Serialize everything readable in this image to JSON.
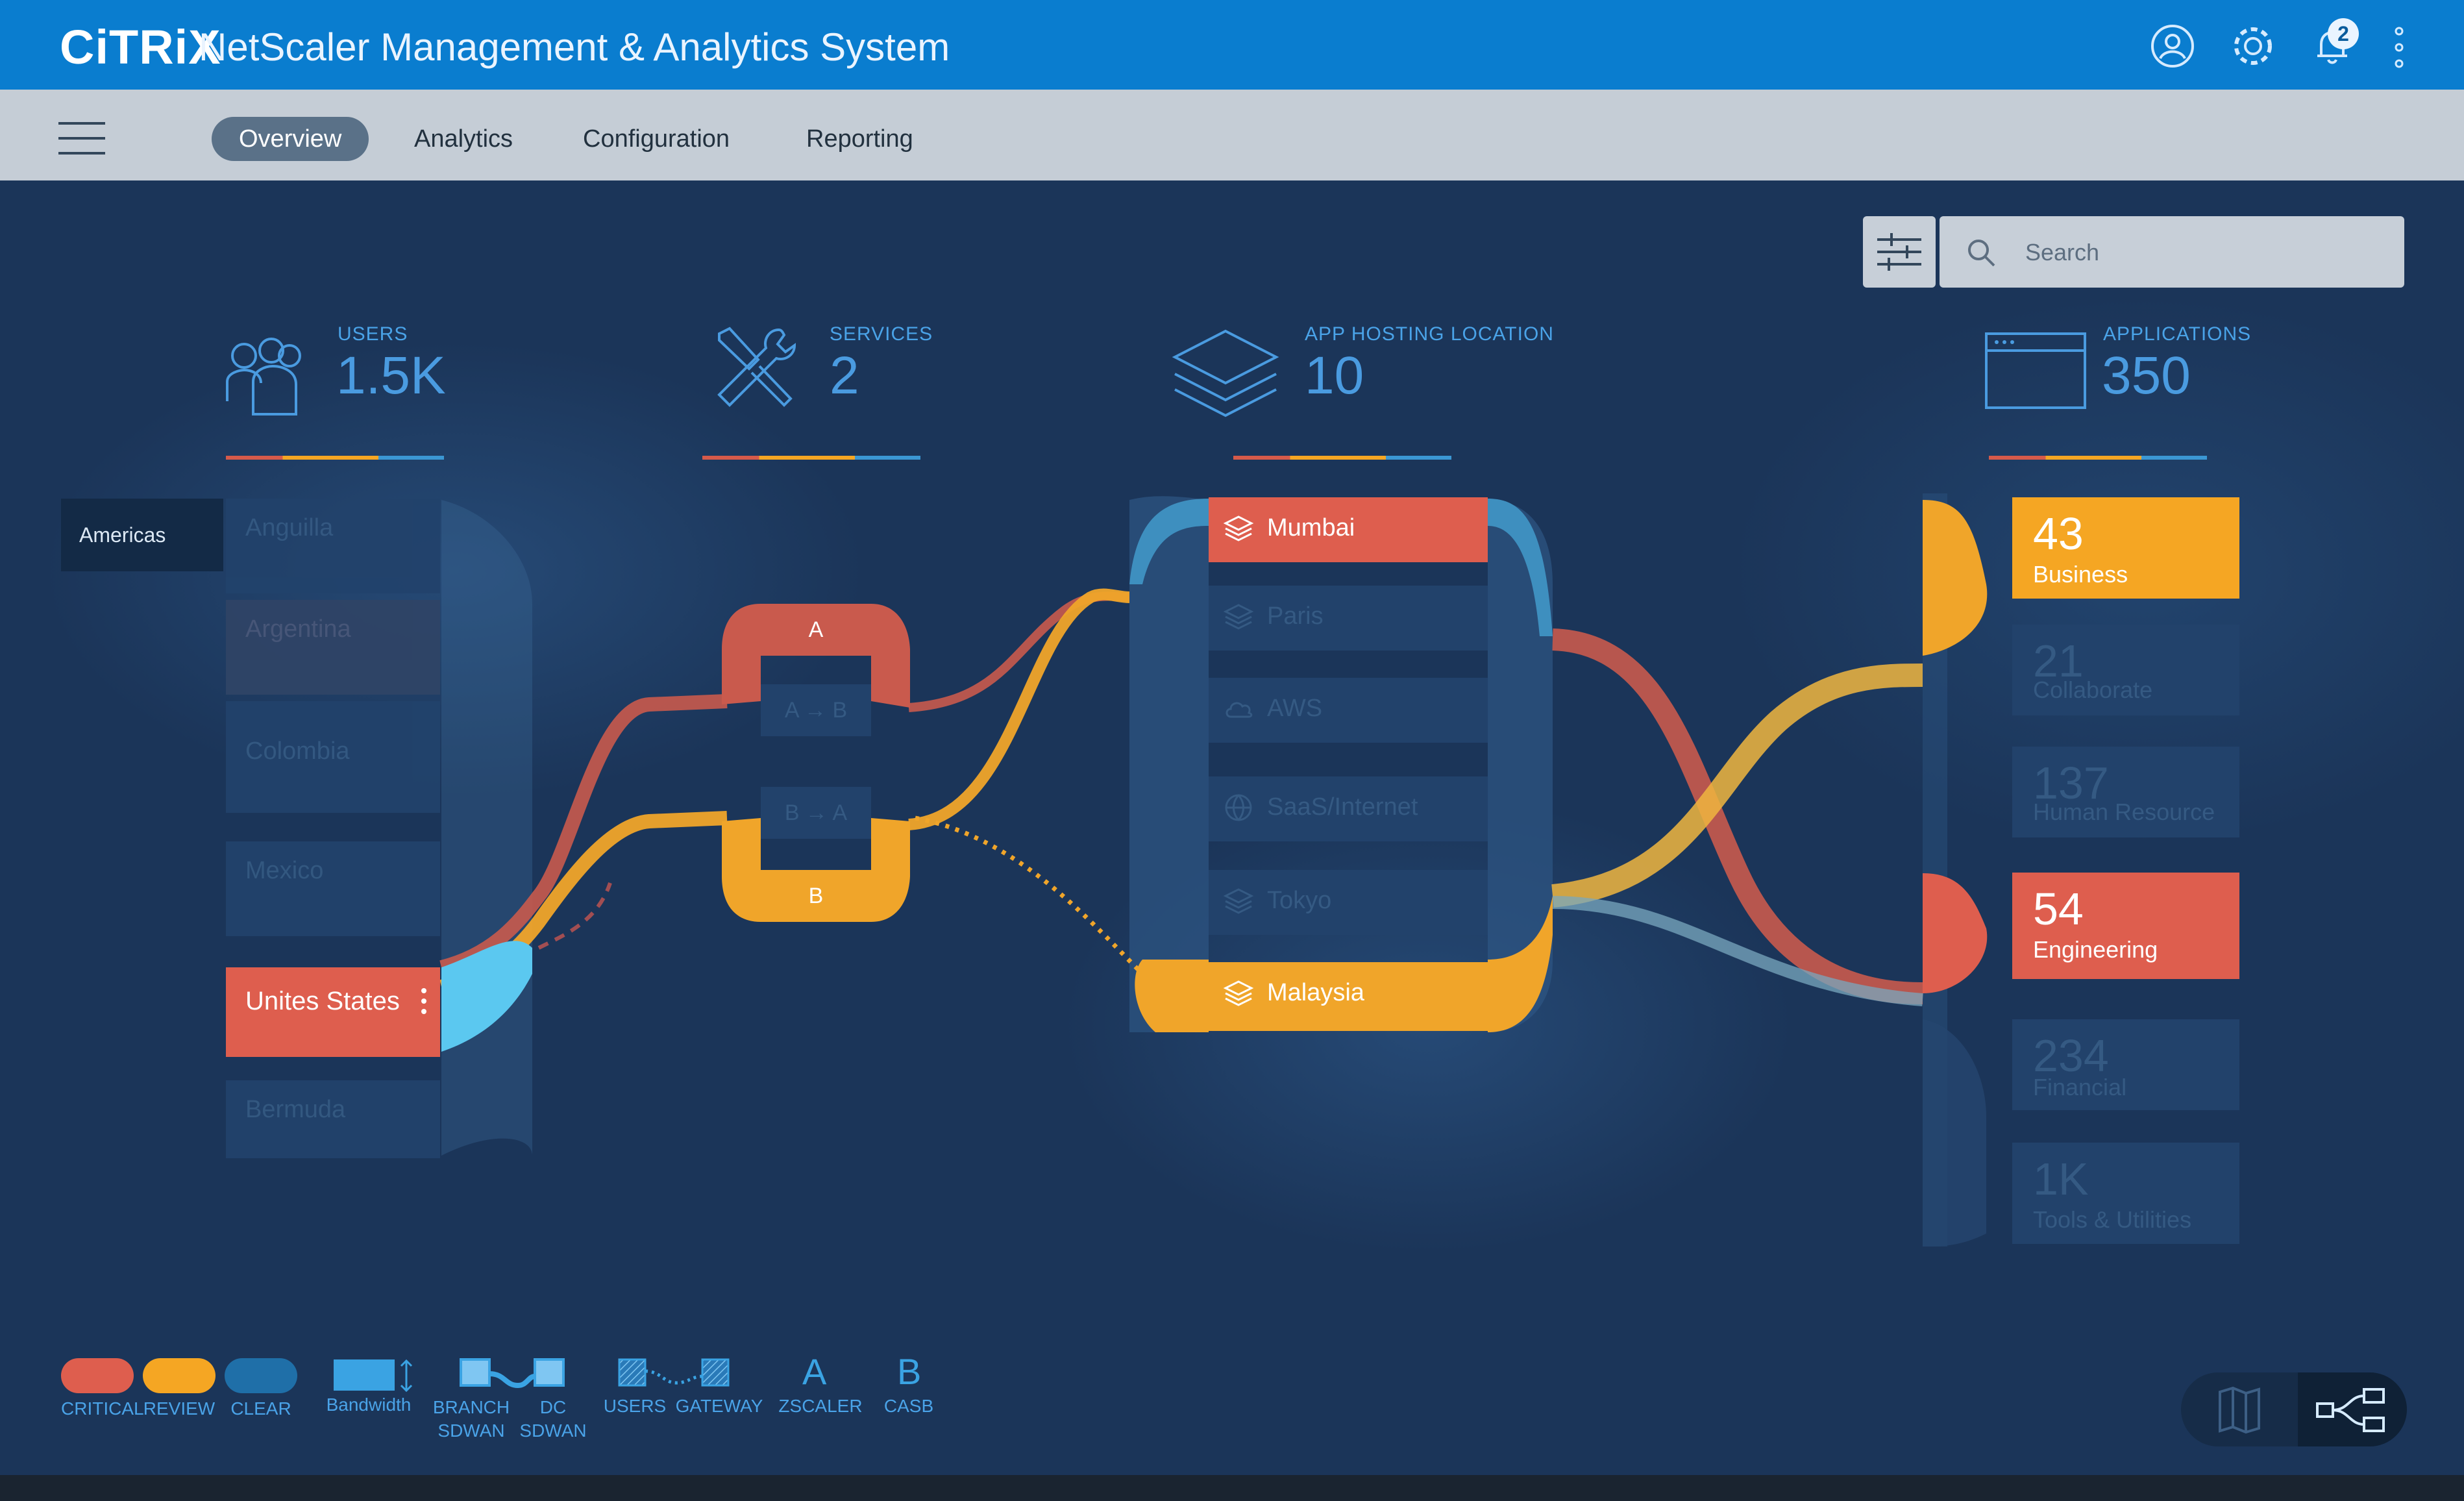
{
  "header": {
    "brand": "CiTRiX",
    "product": "NetScaler Management & Analytics System",
    "notification_count": "2"
  },
  "nav": {
    "tabs": [
      {
        "label": "Overview",
        "active": true
      },
      {
        "label": "Analytics"
      },
      {
        "label": "Configuration"
      },
      {
        "label": "Reporting"
      }
    ]
  },
  "search": {
    "placeholder": "Search"
  },
  "categories": {
    "users": {
      "label": "USERS",
      "count": "1.5K"
    },
    "services": {
      "label": "SERVICES",
      "count": "2"
    },
    "hosting": {
      "label": "APP HOSTING LOCATION",
      "count": "10"
    },
    "applications": {
      "label": "APPLICATIONS",
      "count": "350"
    }
  },
  "region": "Americas",
  "countries": [
    {
      "name": "Anguilla"
    },
    {
      "name": "Argentina"
    },
    {
      "name": "Colombia"
    },
    {
      "name": "Mexico"
    },
    {
      "name": "Unites States",
      "status": "critical"
    },
    {
      "name": "Bermuda"
    }
  ],
  "services": [
    {
      "label": "A",
      "status": "critical"
    },
    {
      "label": "A → B"
    },
    {
      "label": "B → A"
    },
    {
      "label": "B",
      "status": "review"
    }
  ],
  "locations": [
    {
      "label": "Mumbai",
      "status": "critical",
      "icon": "layers-icon"
    },
    {
      "label": "Paris",
      "icon": "layers-icon"
    },
    {
      "label": "AWS",
      "icon": "cloud-icon"
    },
    {
      "label": "SaaS/Internet",
      "icon": "globe-icon"
    },
    {
      "label": "Tokyo",
      "icon": "layers-icon"
    },
    {
      "label": "Malaysia",
      "status": "review",
      "icon": "layers-icon"
    }
  ],
  "applications": [
    {
      "count": "43",
      "label": "Business",
      "status": "review"
    },
    {
      "count": "21",
      "label": "Collaborate"
    },
    {
      "count": "137",
      "label": "Human Resource"
    },
    {
      "count": "54",
      "label": "Engineering",
      "status": "critical"
    },
    {
      "count": "234",
      "label": "Financial"
    },
    {
      "count": "1K",
      "label": "Tools & Utilities"
    }
  ],
  "legend": {
    "critical": "CRITICAL",
    "review": "REVIEW",
    "clear": "CLEAR",
    "bandwidth": "Bandwidth",
    "branch_sdwan": "BRANCH\nSDWAN",
    "dc_sdwan": "DC\nSDWAN",
    "users": "USERS",
    "gateway": "GATEWAY",
    "zscaler_letter": "A",
    "zscaler": "ZSCALER",
    "casb_letter": "B",
    "casb": "CASB"
  },
  "colors": {
    "critical": "#de5e4e",
    "review": "#f5a623",
    "clear": "#1f6fa8",
    "accent": "#0a7dcf",
    "background": "#1b3559"
  }
}
